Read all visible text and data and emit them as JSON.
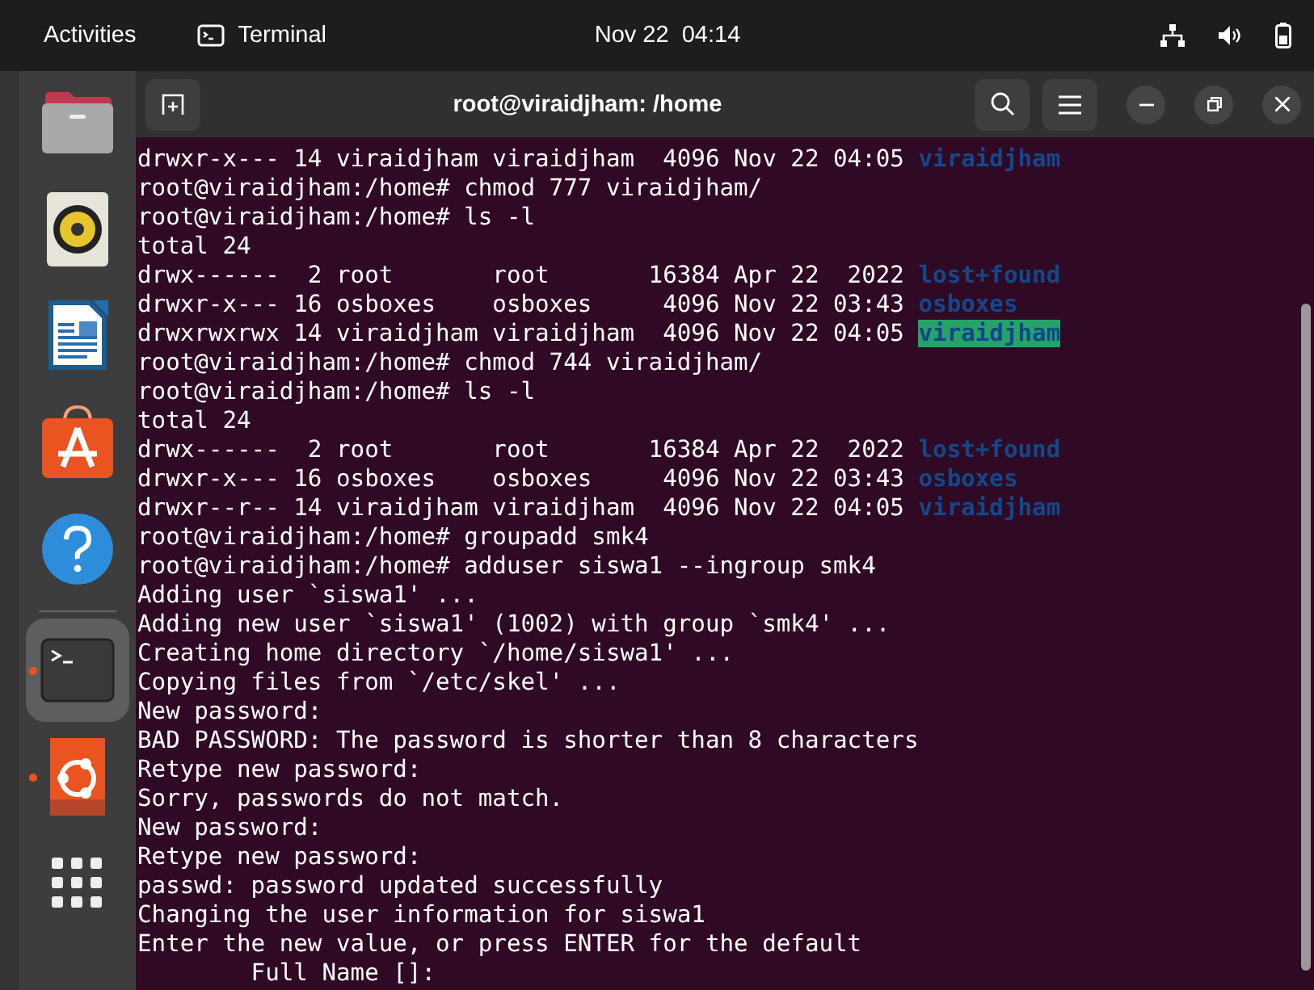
{
  "top_bar": {
    "activities": "Activities",
    "app_name": "Terminal",
    "clock": "Nov 22  04:14"
  },
  "dock": {
    "items": [
      {
        "kind": "files",
        "running": false,
        "selected": false
      },
      {
        "kind": "music",
        "running": false,
        "selected": false
      },
      {
        "kind": "writer",
        "running": false,
        "selected": false
      },
      {
        "kind": "store",
        "running": false,
        "selected": false
      },
      {
        "kind": "help",
        "running": false,
        "selected": false
      },
      {
        "kind": "terminal",
        "running": true,
        "selected": true
      },
      {
        "kind": "installer",
        "running": true,
        "selected": false
      },
      {
        "kind": "apps",
        "running": false,
        "selected": false
      }
    ]
  },
  "window": {
    "title": "root@viraidjham: /home"
  },
  "terminal": {
    "lines": [
      {
        "segments": [
          {
            "text": "drwxr-x--- 14 viraidjham viraidjham  4096 Nov 22 04:05 ",
            "kind": "plain"
          },
          {
            "text": "viraidjham",
            "kind": "dir"
          }
        ]
      },
      {
        "segments": [
          {
            "text": "root@viraidjham:/home# chmod 777 viraidjham/",
            "kind": "plain"
          }
        ]
      },
      {
        "segments": [
          {
            "text": "root@viraidjham:/home# ls -l",
            "kind": "plain"
          }
        ]
      },
      {
        "segments": [
          {
            "text": "total 24",
            "kind": "plain"
          }
        ]
      },
      {
        "segments": [
          {
            "text": "drwx------  2 root       root       16384 Apr 22  2022 ",
            "kind": "plain"
          },
          {
            "text": "lost+found",
            "kind": "dir"
          }
        ]
      },
      {
        "segments": [
          {
            "text": "drwxr-x--- 16 osboxes    osboxes     4096 Nov 22 03:43 ",
            "kind": "plain"
          },
          {
            "text": "osboxes",
            "kind": "dir"
          }
        ]
      },
      {
        "segments": [
          {
            "text": "drwxrwxrwx 14 viraidjham viraidjham  4096 Nov 22 04:05 ",
            "kind": "plain"
          },
          {
            "text": "viraidjham",
            "kind": "dir-writable"
          }
        ]
      },
      {
        "segments": [
          {
            "text": "root@viraidjham:/home# chmod 744 viraidjham/",
            "kind": "plain"
          }
        ]
      },
      {
        "segments": [
          {
            "text": "root@viraidjham:/home# ls -l",
            "kind": "plain"
          }
        ]
      },
      {
        "segments": [
          {
            "text": "total 24",
            "kind": "plain"
          }
        ]
      },
      {
        "segments": [
          {
            "text": "drwx------  2 root       root       16384 Apr 22  2022 ",
            "kind": "plain"
          },
          {
            "text": "lost+found",
            "kind": "dir"
          }
        ]
      },
      {
        "segments": [
          {
            "text": "drwxr-x--- 16 osboxes    osboxes     4096 Nov 22 03:43 ",
            "kind": "plain"
          },
          {
            "text": "osboxes",
            "kind": "dir"
          }
        ]
      },
      {
        "segments": [
          {
            "text": "drwxr--r-- 14 viraidjham viraidjham  4096 Nov 22 04:05 ",
            "kind": "plain"
          },
          {
            "text": "viraidjham",
            "kind": "dir"
          }
        ]
      },
      {
        "segments": [
          {
            "text": "root@viraidjham:/home# groupadd smk4",
            "kind": "plain"
          }
        ]
      },
      {
        "segments": [
          {
            "text": "root@viraidjham:/home# adduser siswa1 --ingroup smk4",
            "kind": "plain"
          }
        ]
      },
      {
        "segments": [
          {
            "text": "Adding user `siswa1' ...",
            "kind": "plain"
          }
        ]
      },
      {
        "segments": [
          {
            "text": "Adding new user `siswa1' (1002) with group `smk4' ...",
            "kind": "plain"
          }
        ]
      },
      {
        "segments": [
          {
            "text": "Creating home directory `/home/siswa1' ...",
            "kind": "plain"
          }
        ]
      },
      {
        "segments": [
          {
            "text": "Copying files from `/etc/skel' ...",
            "kind": "plain"
          }
        ]
      },
      {
        "segments": [
          {
            "text": "New password:",
            "kind": "plain"
          }
        ]
      },
      {
        "segments": [
          {
            "text": "BAD PASSWORD: The password is shorter than 8 characters",
            "kind": "plain"
          }
        ]
      },
      {
        "segments": [
          {
            "text": "Retype new password:",
            "kind": "plain"
          }
        ]
      },
      {
        "segments": [
          {
            "text": "Sorry, passwords do not match.",
            "kind": "plain"
          }
        ]
      },
      {
        "segments": [
          {
            "text": "New password:",
            "kind": "plain"
          }
        ]
      },
      {
        "segments": [
          {
            "text": "Retype new password:",
            "kind": "plain"
          }
        ]
      },
      {
        "segments": [
          {
            "text": "passwd: password updated successfully",
            "kind": "plain"
          }
        ]
      },
      {
        "segments": [
          {
            "text": "Changing the user information for siswa1",
            "kind": "plain"
          }
        ]
      },
      {
        "segments": [
          {
            "text": "Enter the new value, or press ENTER for the default",
            "kind": "plain"
          }
        ]
      },
      {
        "segments": [
          {
            "text": "        Full Name []:",
            "kind": "plain"
          }
        ]
      }
    ]
  }
}
